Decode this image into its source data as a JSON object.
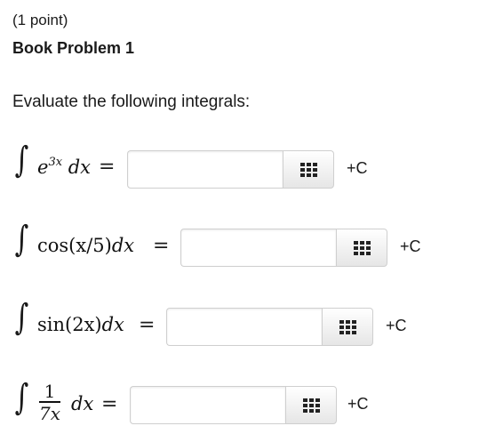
{
  "header": {
    "points": "(1 point)",
    "title": "Book Problem 1"
  },
  "instructions": "Evaluate the following integrals:",
  "integral_symbol": "∫",
  "equals": "=",
  "problems": [
    {
      "integrand": "e",
      "exponent": "3x",
      "differential": "dx",
      "answer_value": "",
      "suffix": "+C"
    },
    {
      "integrand": "cos(x/5)",
      "differential": "dx",
      "answer_value": "",
      "suffix": "+C"
    },
    {
      "integrand": "sin(2x)",
      "differential": "dx",
      "answer_value": "",
      "suffix": "+C"
    },
    {
      "numerator": "1",
      "denominator": "7x",
      "differential": "dx",
      "answer_value": "",
      "suffix": "+C"
    }
  ],
  "palette_icon": "grid-icon"
}
